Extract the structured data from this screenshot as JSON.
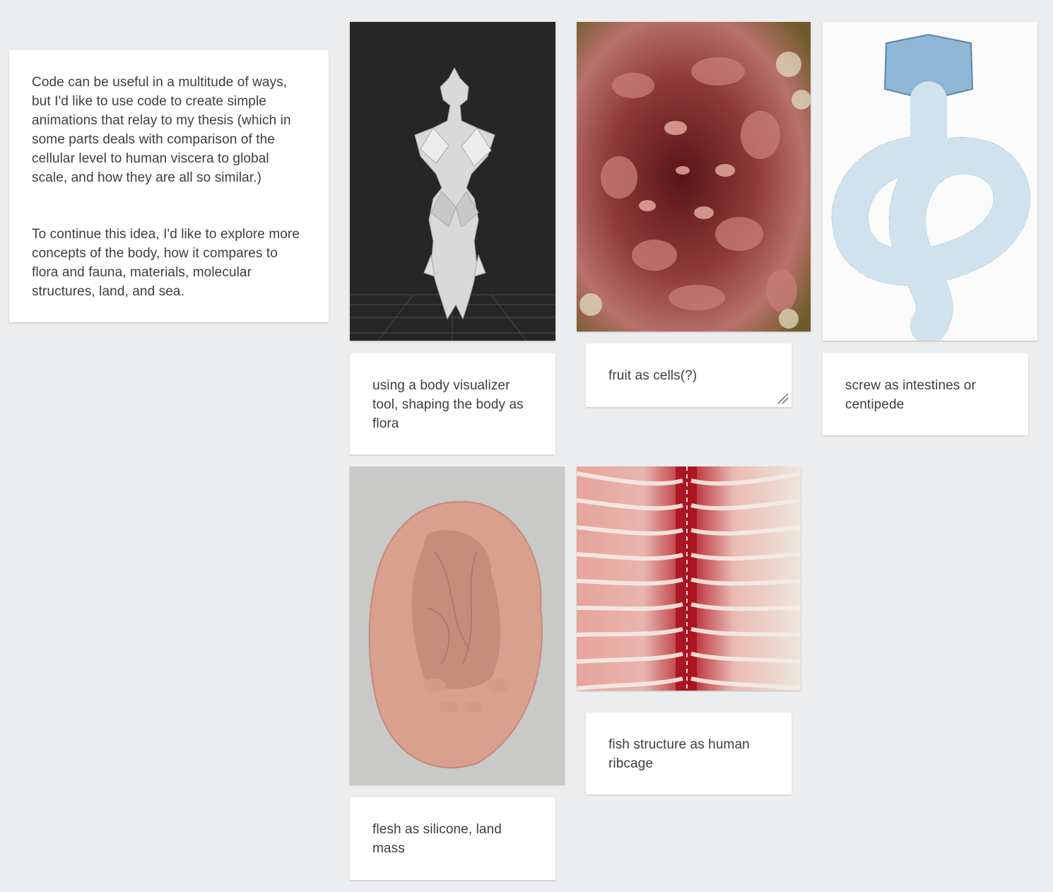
{
  "board": {
    "intro": {
      "paragraph_1": "Code can be useful in a multitude of ways, but I'd like to use code to create simple animations that relay to my thesis (which in some parts deals with comparison of the cellular level to human viscera to global scale, and how they are all so similar.)",
      "paragraph_2": "To continue this idea, I'd like to explore more concepts of the body, how it compares to flora and fauna, materials, molecular structures, land, and sea."
    },
    "captions": {
      "body_visualizer": "using a body visualizer tool, shaping the body as flora",
      "fruit": "fruit as cells(?)",
      "screw": "screw as intestines or centipede",
      "flesh": "flesh as silicone, land mass",
      "fish": "fish structure as human ribcage"
    }
  }
}
